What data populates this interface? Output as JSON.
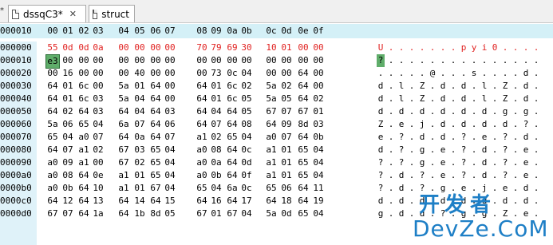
{
  "tabs": [
    {
      "label": "dssqC3*",
      "close": "✕"
    },
    {
      "label": "struct"
    }
  ],
  "edge_marker": "*",
  "header_offset": "000010",
  "columns": [
    "00",
    "01",
    "02",
    "03",
    "04",
    "05",
    "06",
    "07",
    "08",
    "09",
    "0a",
    "0b",
    "0c",
    "0d",
    "0e",
    "0f"
  ],
  "rows": [
    {
      "offset": "000000",
      "hex": [
        "55",
        "0d",
        "0d",
        "0a",
        "00",
        "00",
        "00",
        "00",
        "70",
        "79",
        "69",
        "30",
        "10",
        "01",
        "00",
        "00"
      ],
      "ascii": [
        "U",
        ".",
        ".",
        ".",
        ".",
        ".",
        ".",
        ".",
        "p",
        "y",
        "i",
        "0",
        ".",
        ".",
        ".",
        "."
      ]
    },
    {
      "offset": "000010",
      "hex": [
        "e3",
        "00",
        "00",
        "00",
        "00",
        "00",
        "00",
        "00",
        "00",
        "00",
        "00",
        "00",
        "00",
        "00",
        "00",
        "00"
      ],
      "ascii": [
        "?",
        ".",
        ".",
        ".",
        ".",
        ".",
        ".",
        ".",
        ".",
        ".",
        ".",
        ".",
        ".",
        ".",
        ".",
        "."
      ]
    },
    {
      "offset": "000020",
      "hex": [
        "00",
        "16",
        "00",
        "00",
        "00",
        "40",
        "00",
        "00",
        "00",
        "73",
        "0c",
        "04",
        "00",
        "00",
        "64",
        "00"
      ],
      "ascii": [
        ".",
        ".",
        ".",
        ".",
        ".",
        "@",
        ".",
        ".",
        ".",
        "s",
        ".",
        ".",
        ".",
        ".",
        "d",
        "."
      ]
    },
    {
      "offset": "000030",
      "hex": [
        "64",
        "01",
        "6c",
        "00",
        "5a",
        "01",
        "64",
        "00",
        "64",
        "01",
        "6c",
        "02",
        "5a",
        "02",
        "64",
        "00"
      ],
      "ascii": [
        "d",
        ".",
        "l",
        ".",
        "Z",
        ".",
        "d",
        ".",
        "d",
        ".",
        "l",
        ".",
        "Z",
        ".",
        "d",
        "."
      ]
    },
    {
      "offset": "000040",
      "hex": [
        "64",
        "01",
        "6c",
        "03",
        "5a",
        "04",
        "64",
        "00",
        "64",
        "01",
        "6c",
        "05",
        "5a",
        "05",
        "64",
        "02"
      ],
      "ascii": [
        "d",
        ".",
        "l",
        ".",
        "Z",
        ".",
        "d",
        ".",
        "d",
        ".",
        "l",
        ".",
        "Z",
        ".",
        "d",
        "."
      ]
    },
    {
      "offset": "000050",
      "hex": [
        "64",
        "02",
        "64",
        "03",
        "64",
        "04",
        "64",
        "03",
        "64",
        "04",
        "64",
        "05",
        "67",
        "07",
        "67",
        "01"
      ],
      "ascii": [
        "d",
        ".",
        "d",
        ".",
        "d",
        ".",
        "d",
        ".",
        "d",
        ".",
        "d",
        ".",
        "g",
        ".",
        "g",
        "."
      ]
    },
    {
      "offset": "000060",
      "hex": [
        "5a",
        "06",
        "65",
        "04",
        "6a",
        "07",
        "64",
        "06",
        "64",
        "07",
        "64",
        "08",
        "64",
        "09",
        "8d",
        "03"
      ],
      "ascii": [
        "Z",
        ".",
        "e",
        ".",
        "j",
        ".",
        "d",
        ".",
        "d",
        ".",
        "d",
        ".",
        "d",
        ".",
        "?",
        "."
      ]
    },
    {
      "offset": "000070",
      "hex": [
        "65",
        "04",
        "a0",
        "07",
        "64",
        "0a",
        "64",
        "07",
        "a1",
        "02",
        "65",
        "04",
        "a0",
        "07",
        "64",
        "0b"
      ],
      "ascii": [
        "e",
        ".",
        "?",
        ".",
        "d",
        ".",
        "d",
        ".",
        "?",
        ".",
        "e",
        ".",
        "?",
        ".",
        "d",
        "."
      ]
    },
    {
      "offset": "000080",
      "hex": [
        "64",
        "07",
        "a1",
        "02",
        "67",
        "03",
        "65",
        "04",
        "a0",
        "08",
        "64",
        "0c",
        "a1",
        "01",
        "65",
        "04"
      ],
      "ascii": [
        "d",
        ".",
        "?",
        ".",
        "g",
        ".",
        "e",
        ".",
        "?",
        ".",
        "d",
        ".",
        "?",
        ".",
        "e",
        "."
      ]
    },
    {
      "offset": "000090",
      "hex": [
        "a0",
        "09",
        "a1",
        "00",
        "67",
        "02",
        "65",
        "04",
        "a0",
        "0a",
        "64",
        "0d",
        "a1",
        "01",
        "65",
        "04"
      ],
      "ascii": [
        "?",
        ".",
        "?",
        ".",
        "g",
        ".",
        "e",
        ".",
        "?",
        ".",
        "d",
        ".",
        "?",
        ".",
        "e",
        "."
      ]
    },
    {
      "offset": "0000a0",
      "hex": [
        "a0",
        "08",
        "64",
        "0e",
        "a1",
        "01",
        "65",
        "04",
        "a0",
        "0b",
        "64",
        "0f",
        "a1",
        "01",
        "65",
        "04"
      ],
      "ascii": [
        "?",
        ".",
        "d",
        ".",
        "?",
        ".",
        "e",
        ".",
        "?",
        ".",
        "d",
        ".",
        "?",
        ".",
        "e",
        "."
      ]
    },
    {
      "offset": "0000b0",
      "hex": [
        "a0",
        "0b",
        "64",
        "10",
        "a1",
        "01",
        "67",
        "04",
        "65",
        "04",
        "6a",
        "0c",
        "65",
        "06",
        "64",
        "11"
      ],
      "ascii": [
        "?",
        ".",
        "d",
        ".",
        "?",
        ".",
        "g",
        ".",
        "e",
        ".",
        "j",
        ".",
        "e",
        ".",
        "d",
        "."
      ]
    },
    {
      "offset": "0000c0",
      "hex": [
        "64",
        "12",
        "64",
        "13",
        "64",
        "14",
        "64",
        "15",
        "64",
        "16",
        "64",
        "17",
        "64",
        "18",
        "64",
        "19"
      ],
      "ascii": [
        "d",
        ".",
        "d",
        ".",
        "d",
        ".",
        "d",
        ".",
        "d",
        ".",
        "d",
        ".",
        "d",
        ".",
        "d",
        "."
      ]
    },
    {
      "offset": "0000d0",
      "hex": [
        "67",
        "07",
        "64",
        "1a",
        "64",
        "1b",
        "8d",
        "05",
        "67",
        "01",
        "67",
        "04",
        "5a",
        "0d",
        "65",
        "04"
      ],
      "ascii": [
        "g",
        ".",
        "d",
        ".",
        "d",
        ".",
        "?",
        ".",
        "g",
        ".",
        "g",
        ".",
        "Z",
        ".",
        "e",
        "."
      ]
    }
  ],
  "highlight": {
    "red_row": 0,
    "selected_row": 1,
    "selected_col": 0
  },
  "colors": {
    "header_bg": "#d4f0f7",
    "gutter_bg": "#dff2f9",
    "red": "#e0201f",
    "selection": "#5fad6a"
  },
  "watermark": {
    "cn": "开发者",
    "en": "DevZe.CoM"
  }
}
